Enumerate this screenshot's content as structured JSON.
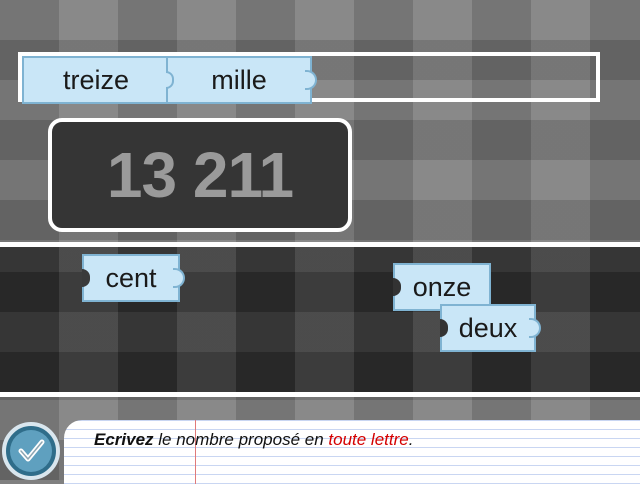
{
  "answer_tiles": [
    {
      "label": "treize"
    },
    {
      "label": "mille"
    }
  ],
  "display": {
    "number": "13 211"
  },
  "word_tiles": [
    {
      "label": "cent"
    },
    {
      "label": "onze"
    },
    {
      "label": "deux"
    }
  ],
  "instruction": {
    "verb": "Ecrivez",
    "middle": " le nombre proposé en ",
    "highlight": "toute lettre",
    "end": "."
  },
  "icons": {
    "validate": "checkmark-icon"
  },
  "colors": {
    "tile": "#c9e6f7",
    "tile_border": "#7fb3d2",
    "highlight": "#d40000",
    "display_bg": "#353535"
  }
}
